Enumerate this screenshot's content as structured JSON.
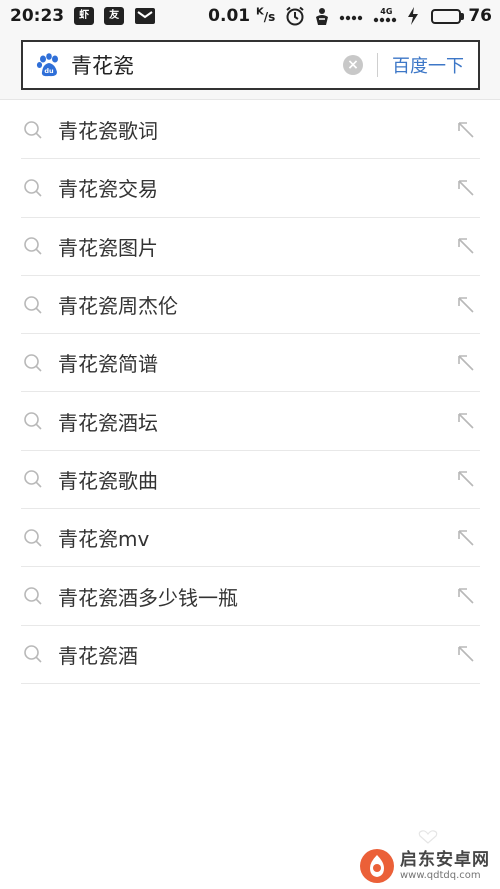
{
  "status_bar": {
    "time": "20:23",
    "app_icon_1": "虾",
    "app_icon_2": "友",
    "net_speed_value": "0.01",
    "net_speed_unit_k": "K",
    "net_speed_unit_s": "/s",
    "network_type": "4G",
    "battery_level": "76",
    "battery_fraction": 0.76,
    "battery_color": "#3cb34a",
    "icons": [
      "message-icon",
      "alarm-icon",
      "notification-icon",
      "signal-icon",
      "signal-4g-icon",
      "charging-icon",
      "battery-icon"
    ]
  },
  "search": {
    "logo_icon": "baidu-paw-icon",
    "query": "青花瓷",
    "clear_icon": "clear-icon",
    "button_label": "百度一下",
    "accent_color": "#3d77c7"
  },
  "suggestions": [
    {
      "text": "青花瓷歌词"
    },
    {
      "text": "青花瓷交易"
    },
    {
      "text": "青花瓷图片"
    },
    {
      "text": "青花瓷周杰伦"
    },
    {
      "text": "青花瓷简谱"
    },
    {
      "text": "青花瓷酒坛"
    },
    {
      "text": "青花瓷歌曲"
    },
    {
      "text": "青花瓷mv"
    },
    {
      "text": "青花瓷酒多少钱一瓶"
    },
    {
      "text": "青花瓷酒"
    }
  ],
  "watermark": {
    "name": "启东安卓网",
    "url": "www.qdtdq.com"
  }
}
